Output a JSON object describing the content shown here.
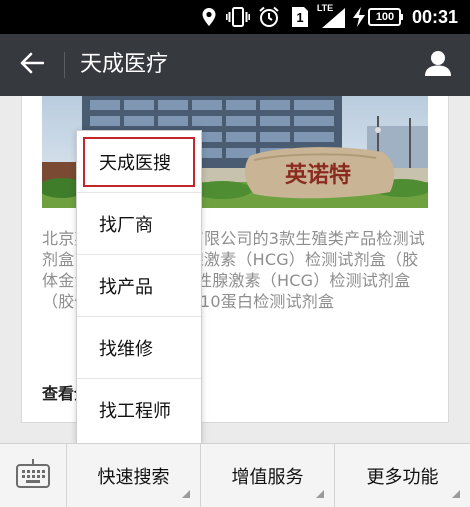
{
  "status_bar": {
    "time": "00:31",
    "sim_label": "1",
    "network_label": "LTE",
    "battery_label": "100",
    "icons": [
      "location-icon",
      "vibrate-icon",
      "alarm-icon",
      "sim-icon",
      "signal-icon",
      "charging-icon",
      "battery-icon"
    ]
  },
  "header": {
    "title": "天成医疗",
    "back_icon": "back-arrow-icon",
    "profile_icon": "person-icon"
  },
  "card": {
    "image_text": "英诺特",
    "description": "北京英诺特生物技术有限公司的3款生殖类产品检测试剂盒：人绒毛膜促性腺激素（HCG）检测试剂盒（胶体金法）、人绒毛膜促性腺激素（HCG）检测试剂盒（胶体金法）、精子SP10蛋白检测试剂盒",
    "more_label": "查看全文"
  },
  "popup_menu": {
    "items": [
      {
        "label": "天成医搜",
        "selected": true
      },
      {
        "label": "找厂商",
        "selected": false
      },
      {
        "label": "找产品",
        "selected": false
      },
      {
        "label": "找维修",
        "selected": false
      },
      {
        "label": "找工程师",
        "selected": false
      }
    ]
  },
  "bottom_menu": {
    "keyboard_icon": "keyboard-icon",
    "buttons": [
      "快速搜索",
      "增值服务",
      "更多功能"
    ]
  },
  "colors": {
    "title_bar": "#36393e",
    "status_bar": "#000000",
    "selected_outline": "#c2272d"
  }
}
